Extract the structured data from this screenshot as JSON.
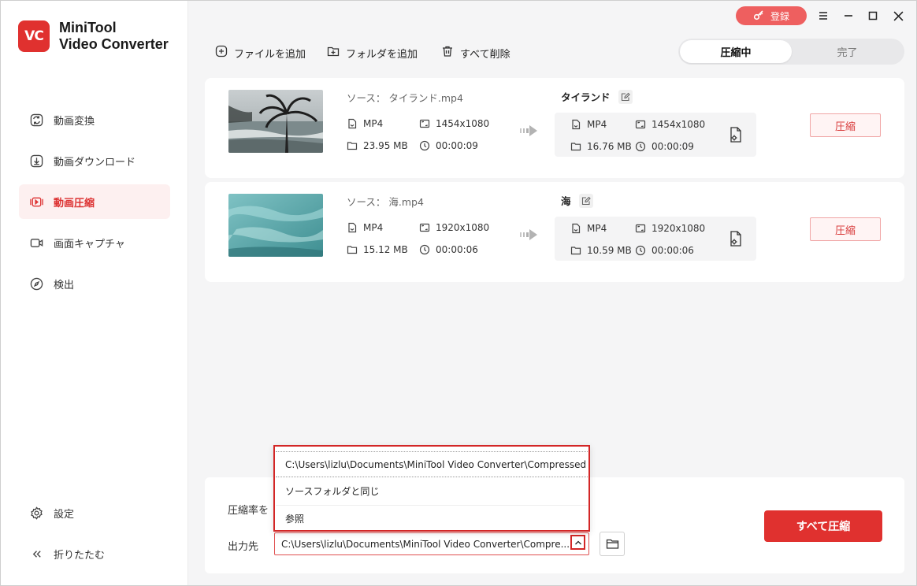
{
  "app": {
    "logo_text": "VC",
    "name_line1": "MiniTool",
    "name_line2": "Video Converter"
  },
  "titlebar": {
    "register_label": "登録",
    "menu_icon": "hamburger-icon",
    "minimize_icon": "minimize-icon",
    "maximize_icon": "maximize-icon",
    "close_icon": "close-icon"
  },
  "sidebar": {
    "items": [
      {
        "label": "動画変換",
        "icon": "convert-icon",
        "active": false
      },
      {
        "label": "動画ダウンロード",
        "icon": "download-icon",
        "active": false
      },
      {
        "label": "動画圧縮",
        "icon": "compress-icon",
        "active": true
      },
      {
        "label": "画面キャプチャ",
        "icon": "camera-icon",
        "active": false
      },
      {
        "label": "検出",
        "icon": "compass-icon",
        "active": false
      }
    ],
    "settings_label": "設定",
    "collapse_label": "折りたたむ"
  },
  "toolbar": {
    "add_file": "ファイルを追加",
    "add_folder": "フォルダを追加",
    "delete_all": "すべて削除",
    "tab_compressing": "圧縮中",
    "tab_done": "完了"
  },
  "tasks": [
    {
      "source_label": "ソース：",
      "source_name": "タイランド.mp4",
      "format": "MP4",
      "resolution": "1454x1080",
      "size": "23.95 MB",
      "duration": "00:00:09",
      "output_name": "タイランド",
      "out_format": "MP4",
      "out_resolution": "1454x1080",
      "out_size": "16.76 MB",
      "out_duration": "00:00:09",
      "button": "圧縮"
    },
    {
      "source_label": "ソース：",
      "source_name": "海.mp4",
      "format": "MP4",
      "resolution": "1920x1080",
      "size": "15.12 MB",
      "duration": "00:00:06",
      "output_name": "海",
      "out_format": "MP4",
      "out_resolution": "1920x1080",
      "out_size": "10.59 MB",
      "out_duration": "00:00:06",
      "button": "圧縮"
    }
  ],
  "bottom": {
    "ratio_label": "圧縮率を",
    "output_label": "出力先",
    "output_path": "C:\\Users\\lizlu\\Documents\\MiniTool Video Converter\\Compre...",
    "compress_all": "すべて圧縮"
  },
  "dropdown": {
    "options": [
      "C:\\Users\\lizlu\\Documents\\MiniTool Video Converter\\Compressed",
      "ソースフォルダと同じ",
      "参照"
    ]
  },
  "colors": {
    "accent": "#e0312f",
    "register": "#ee5f5f",
    "active_bg": "#fdf0f0"
  }
}
